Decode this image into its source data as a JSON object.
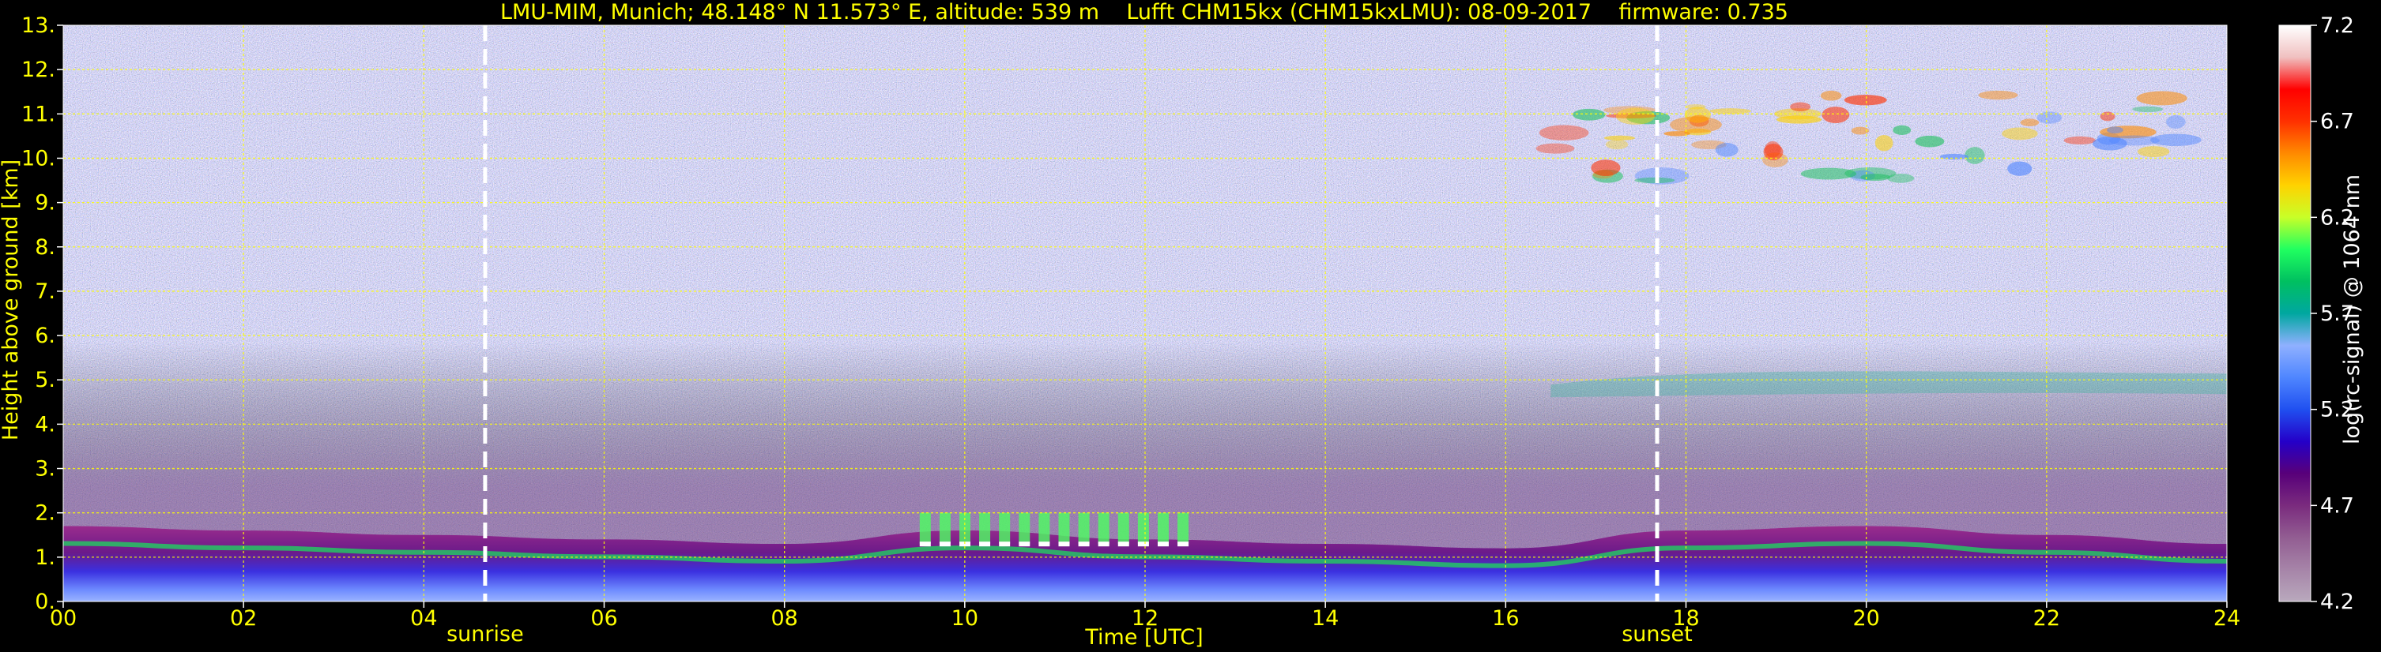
{
  "chart_data": {
    "type": "heatmap",
    "title": "LMU-MIM, Munich; 48.148° N 11.573° E, altitude: 539 m    Lufft CHM15kx (CHM15kxLMU): 08-09-2017    firmware: 0.735",
    "xlabel": "Time [UTC]",
    "ylabel": "Height above ground [km]",
    "xlim": [
      0,
      24
    ],
    "ylim": [
      0,
      13
    ],
    "x_ticks": [
      "00",
      "02",
      "04",
      "06",
      "08",
      "10",
      "12",
      "14",
      "16",
      "18",
      "20",
      "22",
      "24"
    ],
    "x_tick_values": [
      0,
      2,
      4,
      6,
      8,
      10,
      12,
      14,
      16,
      18,
      20,
      22,
      24
    ],
    "y_ticks": [
      "0.",
      "1.",
      "2.",
      "3.",
      "4.",
      "5.",
      "6.",
      "7.",
      "8.",
      "9.",
      "10.",
      "11.",
      "12.",
      "13."
    ],
    "y_tick_values": [
      0,
      1,
      2,
      3,
      4,
      5,
      6,
      7,
      8,
      9,
      10,
      11,
      12,
      13
    ],
    "grid": true,
    "grid_color": "#ffff00",
    "annotations": [
      {
        "label": "sunrise",
        "x": 4.68
      },
      {
        "label": "sunset",
        "x": 17.68
      }
    ],
    "colorbar": {
      "label": "log(rc-signal) @ 1064 nm",
      "range": [
        4.2,
        7.2
      ],
      "ticks": [
        "4.2",
        "4.7",
        "5.2",
        "5.7",
        "6.2",
        "6.7",
        "7.2"
      ],
      "tick_values": [
        4.2,
        4.7,
        5.2,
        5.7,
        6.2,
        6.7,
        7.2
      ],
      "colors": [
        "#b9a9bd",
        "#a684a8",
        "#925d92",
        "#7a2b7e",
        "#58007a",
        "#2400c8",
        "#2050f0",
        "#4f86ff",
        "#8fb0ff",
        "#00a7a0",
        "#00c060",
        "#20ff60",
        "#c8ff28",
        "#ffd200",
        "#ff8a00",
        "#ff3000",
        "#ff0000",
        "#f0c0c0",
        "#ffffff"
      ]
    },
    "layers": [
      {
        "name": "boundary layer",
        "x_range": [
          0,
          24
        ],
        "top_km": [
          1.7,
          1.6,
          1.5,
          1.4,
          1.3,
          1.6,
          1.4,
          1.3,
          1.2,
          1.6,
          1.7,
          1.5,
          1.3
        ]
      },
      {
        "name": "aerosol layer",
        "x_range": [
          16.5,
          24
        ],
        "height_km": 5.0
      },
      {
        "name": "cirrus",
        "x_range": [
          16.5,
          23.5
        ],
        "height_km": [
          9.5,
          11.5
        ]
      }
    ],
    "colors": {
      "background": "#000000",
      "text": "#ffff00",
      "colorbar_text": "#ffffff",
      "marker_line": "#ffffff"
    }
  }
}
